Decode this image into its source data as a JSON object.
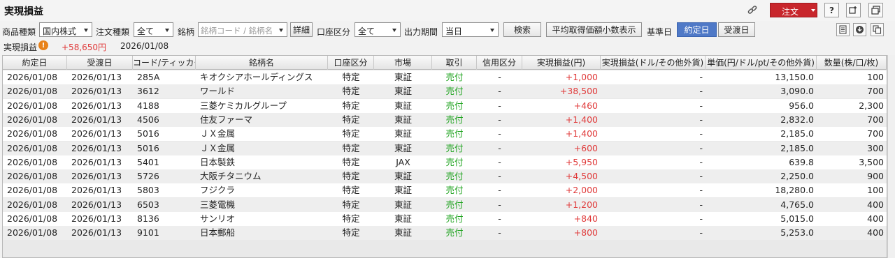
{
  "title": "実現損益",
  "header_buttons": {
    "order_label": "注文",
    "help_label": "?"
  },
  "filters": {
    "product_type_label": "商品種類",
    "product_type_value": "国内株式",
    "order_type_label": "注文種類",
    "order_type_value": "全て",
    "symbol_label": "銘柄",
    "symbol_placeholder": "銘柄コード / 銘柄名",
    "detail_label": "詳細",
    "account_label": "口座区分",
    "account_value": "全て",
    "period_label": "出力期間",
    "period_value": "当日",
    "search_label": "検索",
    "avg_price_label": "平均取得価額小数表示",
    "base_date_label": "基準日",
    "trade_date_label": "約定日",
    "settle_date_label": "受渡日"
  },
  "summary": {
    "label": "実現損益",
    "value": "+58,650円",
    "date": "2026/01/08"
  },
  "table": {
    "columns": [
      "約定日",
      "受渡日",
      "コード/ティッカー",
      "銘柄名",
      "口座区分",
      "市場",
      "取引",
      "信用区分",
      "実現損益(円)",
      "実現損益(ドル/その他外貨)",
      "単価(円/ドル/pt/その他外貨)",
      "数量(株/口/枚)"
    ],
    "rows": [
      [
        "2026/01/08",
        "2026/01/13",
        "285A",
        "キオクシアホールディングス",
        "特定",
        "東証",
        "売付",
        "-",
        "+1,000",
        "-",
        "13,150.0",
        "100"
      ],
      [
        "2026/01/08",
        "2026/01/13",
        "3612",
        "ワールド",
        "特定",
        "東証",
        "売付",
        "-",
        "+38,500",
        "-",
        "3,090.0",
        "700"
      ],
      [
        "2026/01/08",
        "2026/01/13",
        "4188",
        "三菱ケミカルグループ",
        "特定",
        "東証",
        "売付",
        "-",
        "+460",
        "-",
        "956.0",
        "2,300"
      ],
      [
        "2026/01/08",
        "2026/01/13",
        "4506",
        "住友ファーマ",
        "特定",
        "東証",
        "売付",
        "-",
        "+1,400",
        "-",
        "2,832.0",
        "700"
      ],
      [
        "2026/01/08",
        "2026/01/13",
        "5016",
        "ＪＸ金属",
        "特定",
        "東証",
        "売付",
        "-",
        "+1,400",
        "-",
        "2,185.0",
        "700"
      ],
      [
        "2026/01/08",
        "2026/01/13",
        "5016",
        "ＪＸ金属",
        "特定",
        "東証",
        "売付",
        "-",
        "+600",
        "-",
        "2,185.0",
        "300"
      ],
      [
        "2026/01/08",
        "2026/01/13",
        "5401",
        "日本製鉄",
        "特定",
        "JAX",
        "売付",
        "-",
        "+5,950",
        "-",
        "639.8",
        "3,500"
      ],
      [
        "2026/01/08",
        "2026/01/13",
        "5726",
        "大阪チタニウム",
        "特定",
        "東証",
        "売付",
        "-",
        "+4,500",
        "-",
        "2,250.0",
        "900"
      ],
      [
        "2026/01/08",
        "2026/01/13",
        "5803",
        "フジクラ",
        "特定",
        "東証",
        "売付",
        "-",
        "+2,000",
        "-",
        "18,280.0",
        "100"
      ],
      [
        "2026/01/08",
        "2026/01/13",
        "6503",
        "三菱電機",
        "特定",
        "東証",
        "売付",
        "-",
        "+1,200",
        "-",
        "4,765.0",
        "400"
      ],
      [
        "2026/01/08",
        "2026/01/13",
        "8136",
        "サンリオ",
        "特定",
        "東証",
        "売付",
        "-",
        "+840",
        "-",
        "5,015.0",
        "400"
      ],
      [
        "2026/01/08",
        "2026/01/13",
        "9101",
        "日本郵船",
        "特定",
        "東証",
        "売付",
        "-",
        "+800",
        "-",
        "5,253.0",
        "400"
      ]
    ]
  },
  "colors": {
    "order_button": "#c8262c",
    "profit": "#e03a3a",
    "sell": "#1fa31f",
    "active_segment": "#4f79c7"
  },
  "icons": [
    "link-icon",
    "help-icon",
    "detach-window-icon",
    "new-window-icon",
    "print-icon",
    "download-icon",
    "copy-icon",
    "warning-icon"
  ]
}
